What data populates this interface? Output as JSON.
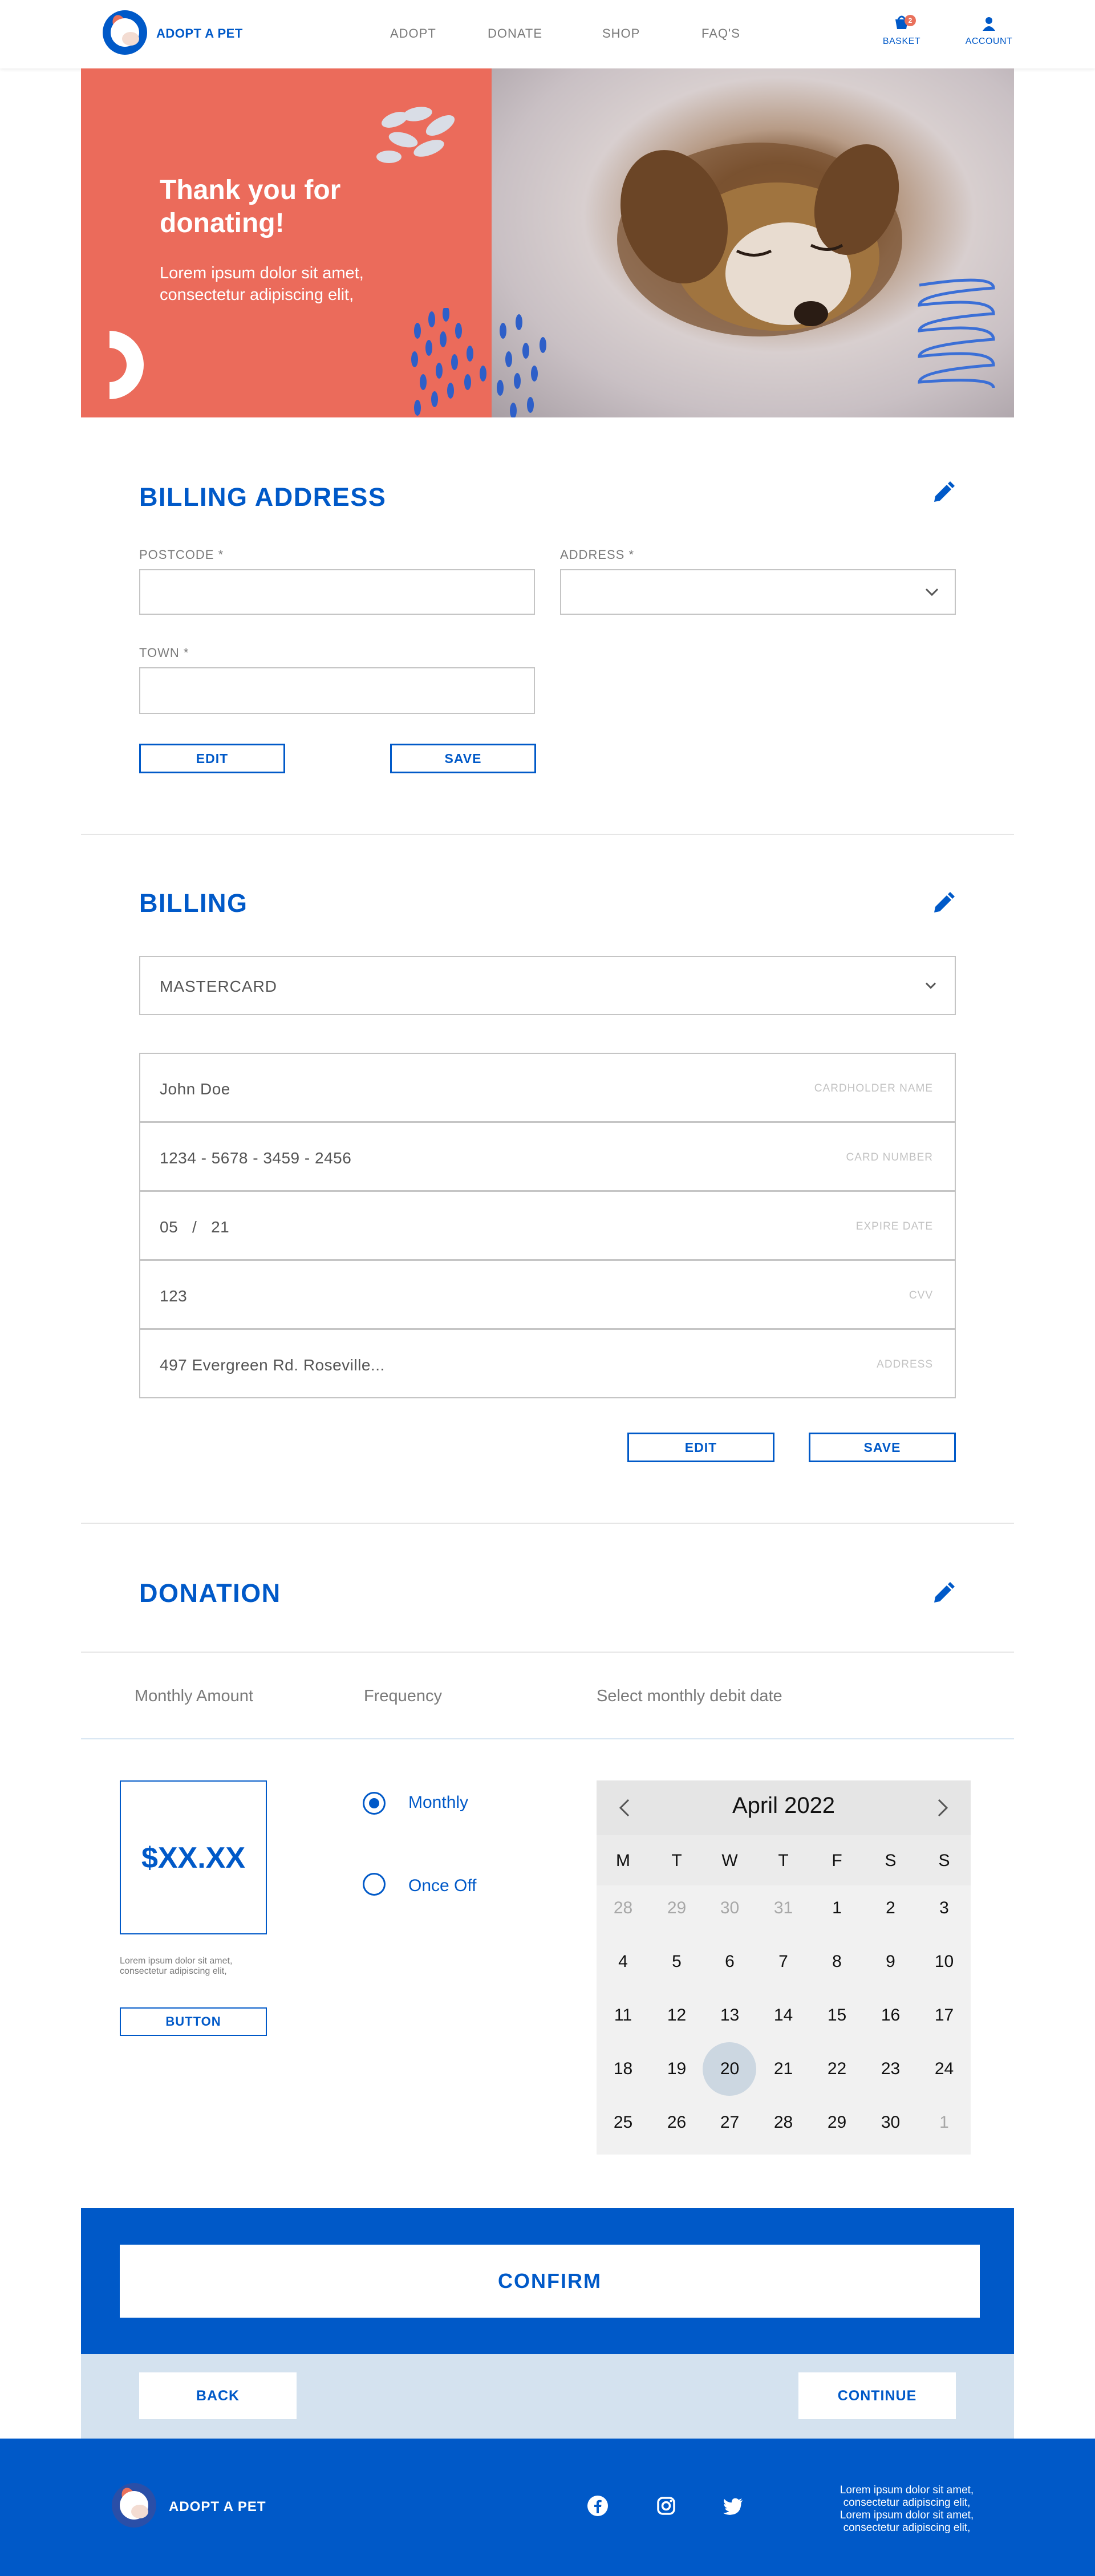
{
  "header": {
    "brand": "ADOPT A PET",
    "nav": [
      "ADOPT",
      "DONATE",
      "SHOP",
      "FAQ'S"
    ],
    "basket_label": "BASKET",
    "basket_count": "2",
    "account_label": "ACCOUNT",
    "basket_icon": "basket-icon",
    "account_icon": "user-icon"
  },
  "hero": {
    "title_line1": "Thank you for",
    "title_line2": "donating!",
    "subtitle_line1": "Lorem ipsum dolor sit amet,",
    "subtitle_line2": "consectetur adipiscing elit,"
  },
  "billing_address": {
    "title": "BILLING ADDRESS",
    "postcode_label": "POSTCODE *",
    "address_label": "ADDRESS *",
    "town_label": "TOWN *",
    "postcode_value": "",
    "address_value": "",
    "town_value": "",
    "edit_label": "EDIT",
    "save_label": "SAVE"
  },
  "billing": {
    "title": "BILLING",
    "card_type": "MASTERCARD",
    "rows": [
      {
        "value": "John Doe",
        "hint": "CARDHOLDER NAME"
      },
      {
        "value": "1234 - 5678 - 3459 - 2456",
        "hint": "CARD NUMBER"
      },
      {
        "value": "05   /   21",
        "hint": "EXPIRE DATE"
      },
      {
        "value": "123",
        "hint": "CVV"
      },
      {
        "value": "497 Evergreen Rd. Roseville...",
        "hint": "ADDRESS"
      }
    ],
    "edit_label": "EDIT",
    "save_label": "SAVE"
  },
  "donation": {
    "title": "DONATION",
    "col_amount": "Monthly Amount",
    "col_frequency": "Frequency",
    "col_date": "Select monthly debit date",
    "amount": "$XX.XX",
    "amount_note_line1": "Lorem ipsum dolor sit amet,",
    "amount_note_line2": "consectetur adipiscing elit,",
    "amount_button": "BUTTON",
    "freq_monthly": "Monthly",
    "freq_once": "Once Off",
    "selected_frequency": "Monthly"
  },
  "calendar": {
    "title": "April 2022",
    "dow": [
      "M",
      "T",
      "W",
      "T",
      "F",
      "S",
      "S"
    ],
    "weeks": [
      [
        "28",
        "29",
        "30",
        "31",
        "1",
        "2",
        "3"
      ],
      [
        "4",
        "5",
        "6",
        "7",
        "8",
        "9",
        "10"
      ],
      [
        "11",
        "12",
        "13",
        "14",
        "15",
        "16",
        "17"
      ],
      [
        "18",
        "19",
        "20",
        "21",
        "22",
        "23",
        "24"
      ],
      [
        "25",
        "26",
        "27",
        "28",
        "29",
        "30",
        "1"
      ]
    ],
    "selected": "20"
  },
  "actions": {
    "confirm": "CONFIRM",
    "back": "BACK",
    "continue": "CONTINUE"
  },
  "footer": {
    "brand": "ADOPT A PET",
    "text_line1": "Lorem ipsum dolor sit amet,",
    "text_line2": "consectetur adipiscing elit,",
    "text_line3": "Lorem ipsum dolor sit amet,",
    "text_line4": "consectetur adipiscing elit,",
    "social": [
      "facebook-icon",
      "instagram-icon",
      "twitter-icon"
    ]
  },
  "colors": {
    "primary": "#0059c8",
    "coral": "#eb6b5b",
    "light_blue": "#d4e2ef"
  }
}
